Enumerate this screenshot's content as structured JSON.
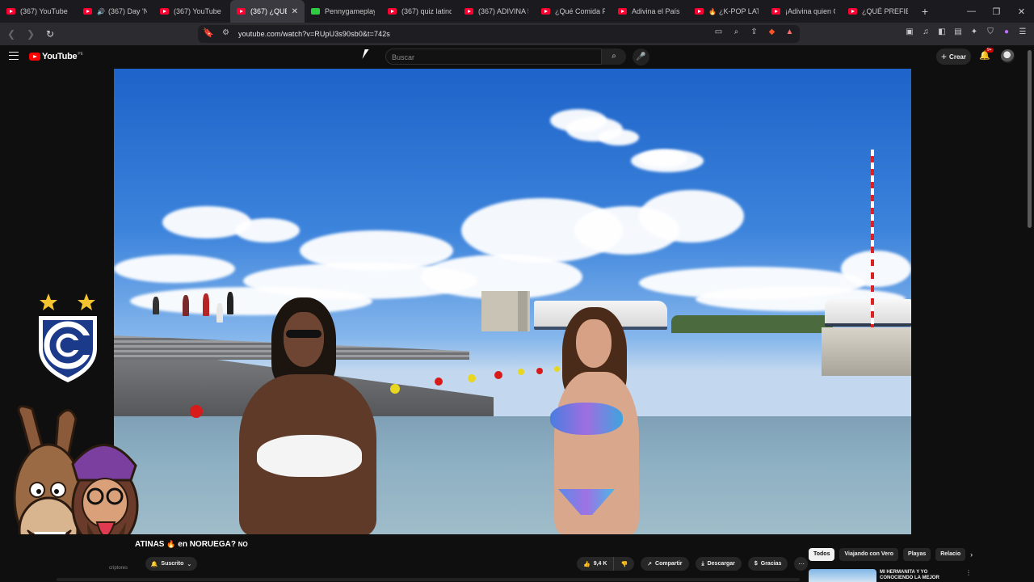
{
  "browser": {
    "tabs": [
      {
        "label": "(367) YouTube",
        "icon": "youtube-icon"
      },
      {
        "label": "(367) Day 'N",
        "icon": "youtube-icon",
        "sound": true
      },
      {
        "label": "(367) YouTube",
        "icon": "youtube-icon"
      },
      {
        "label": "(367) ¿QUÉ P",
        "icon": "youtube-icon",
        "active": true
      },
      {
        "label": "Pennygameplay S",
        "icon": "kick-icon"
      },
      {
        "label": "(367) quiz latino",
        "icon": "youtube-icon"
      },
      {
        "label": "(367) ADIVINA 5C",
        "icon": "youtube-icon"
      },
      {
        "label": "¿Qué Comida Pre",
        "icon": "youtube-icon"
      },
      {
        "label": "Adivina el País po",
        "icon": "youtube-icon"
      },
      {
        "label": "¿K-POP LATIN",
        "icon": "youtube-icon",
        "fire": true
      },
      {
        "label": "¡Adivina quien Ca",
        "icon": "youtube-icon"
      },
      {
        "label": "¿QUÉ PREFIERES",
        "icon": "youtube-icon"
      }
    ],
    "url": "youtube.com/watch?v=RUpU3s90sb0&t=742s"
  },
  "youtube": {
    "logo_text": "YouTube",
    "country_code": "PE",
    "search_placeholder": "Buscar",
    "create_label": "Crear",
    "notification_count": "9+"
  },
  "video": {
    "title_visible": "ATINAS",
    "title_rest": "en NORUEGA?",
    "title_suffix": "NO",
    "subscribe_label": "Suscrito",
    "subscribers_fragment": "criptores",
    "likes": "9,4 K",
    "share_label": "Compartir",
    "download_label": "Descargar",
    "thanks_label": "Gracias"
  },
  "sidebar": {
    "chips": [
      "Todos",
      "Viajando con Vero",
      "Playas",
      "Relacio"
    ],
    "recommendation_title": "MI HERMANITA Y YO CONOCIENDO LA MEJOR"
  },
  "colors": {
    "youtube_red": "#ff0000",
    "background": "#0f0f0f",
    "chip_selected": "#f1f1f1"
  }
}
